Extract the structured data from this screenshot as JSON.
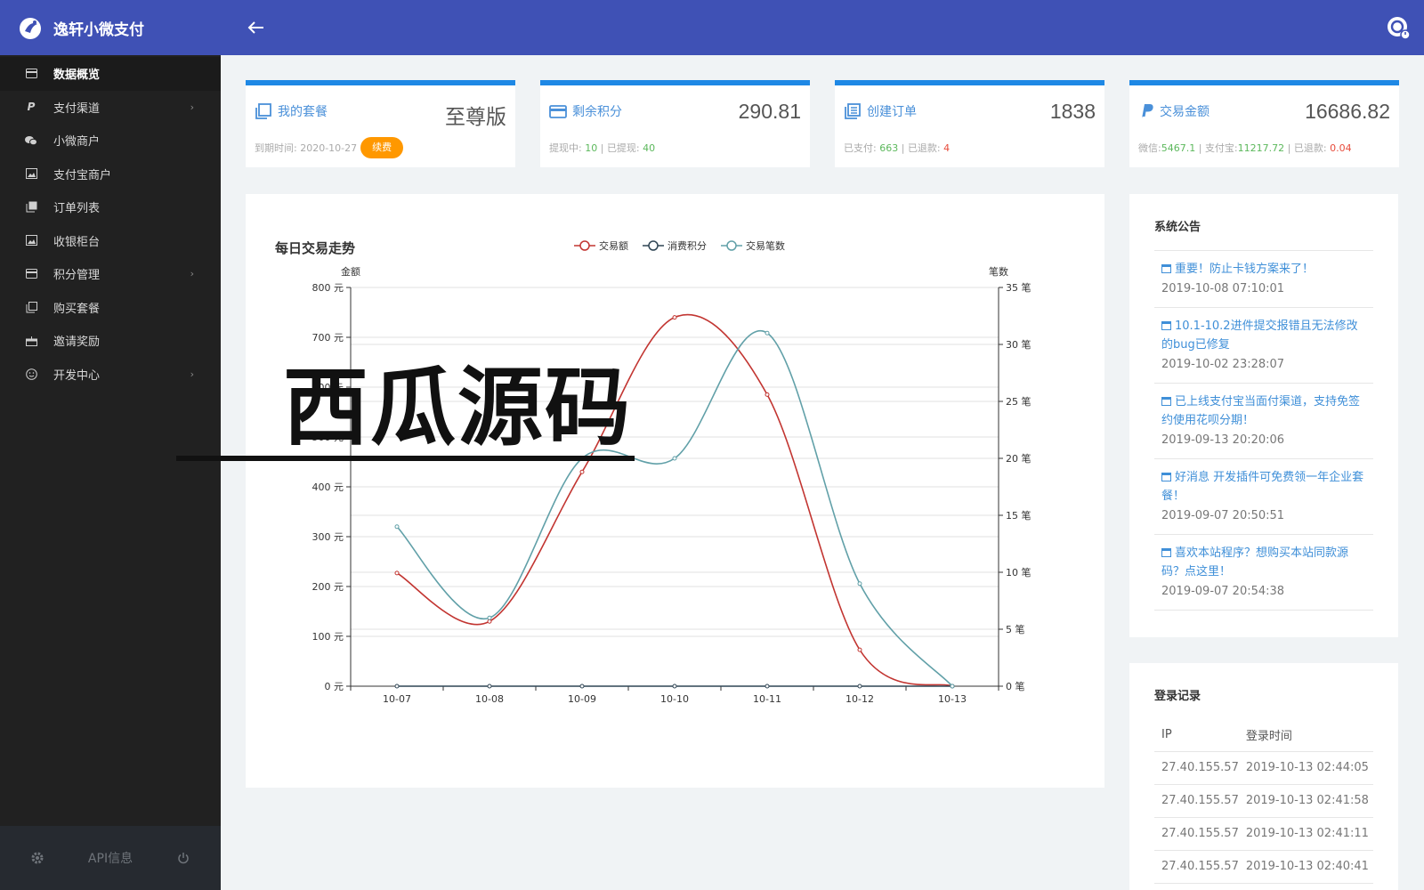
{
  "app": {
    "title": "逸轩小微支付"
  },
  "sidebar": {
    "items": [
      {
        "label": "数据概览",
        "icon": "card-icon",
        "active": true,
        "chevron": false
      },
      {
        "label": "支付渠道",
        "icon": "paypal-p-icon",
        "active": false,
        "chevron": true
      },
      {
        "label": "小微商户",
        "icon": "wechat-icon",
        "active": false,
        "chevron": false
      },
      {
        "label": "支付宝商户",
        "icon": "image-icon",
        "active": false,
        "chevron": false
      },
      {
        "label": "订单列表",
        "icon": "copy-icon",
        "active": false,
        "chevron": false
      },
      {
        "label": "收银柜台",
        "icon": "image-icon",
        "active": false,
        "chevron": false
      },
      {
        "label": "积分管理",
        "icon": "card-icon",
        "active": false,
        "chevron": true
      },
      {
        "label": "购买套餐",
        "icon": "clone-icon",
        "active": false,
        "chevron": false
      },
      {
        "label": "邀请奖励",
        "icon": "gift-icon",
        "active": false,
        "chevron": false
      },
      {
        "label": "开发中心",
        "icon": "smile-icon",
        "active": false,
        "chevron": true
      }
    ],
    "footer": {
      "api_label": "API信息"
    }
  },
  "stats": {
    "package": {
      "label": "我的套餐",
      "value": "至尊版",
      "expire_label": "到期时间:",
      "expire_date": "2020-10-27",
      "renew_label": "续费"
    },
    "points": {
      "label": "剩余积分",
      "value": "290.81",
      "withdrawing_label": "提现中:",
      "withdrawing": "10",
      "sep": "|",
      "withdrawn_label": "已提现:",
      "withdrawn": "40"
    },
    "orders": {
      "label": "创建订单",
      "value": "1838",
      "paid_label": "已支付:",
      "paid": "663",
      "sep": "|",
      "refunded_label": "已退款:",
      "refunded": "4"
    },
    "amount": {
      "label": "交易金额",
      "value": "16686.82",
      "wechat_label": "微信:",
      "wechat": "5467.1",
      "sep1": "|",
      "alipay_label": "支付宝:",
      "alipay": "11217.72",
      "sep2": "|",
      "refunded_label": "已退款:",
      "refunded": "0.04"
    }
  },
  "chart_data": {
    "type": "line",
    "title": "每日交易走势",
    "categories": [
      "10-07",
      "10-08",
      "10-09",
      "10-10",
      "10-11",
      "10-12",
      "10-13"
    ],
    "y_left": {
      "label": "金额",
      "min": 0,
      "max": 800,
      "ticks": [
        0,
        100,
        200,
        300,
        400,
        500,
        600,
        700,
        800
      ],
      "unit": "元"
    },
    "y_right": {
      "label": "笔数",
      "min": 0,
      "max": 35,
      "ticks": [
        0,
        5,
        10,
        15,
        20,
        25,
        30,
        35
      ],
      "unit": "笔"
    },
    "legend_position": "top-center",
    "grid": true,
    "series": [
      {
        "name": "交易额",
        "axis": "left",
        "color": "#c23531",
        "values": [
          227,
          130,
          430,
          740,
          585,
          73,
          0
        ]
      },
      {
        "name": "消费积分",
        "axis": "left",
        "color": "#2f4554",
        "values": [
          0,
          0,
          0,
          0,
          0,
          0,
          0
        ]
      },
      {
        "name": "交易笔数",
        "axis": "right",
        "color": "#61a0a8",
        "values": [
          14,
          6,
          20,
          20,
          31,
          9,
          0
        ]
      }
    ]
  },
  "notices": {
    "title": "系统公告",
    "items": [
      {
        "text": "重要！防止卡钱方案来了！",
        "time": "2019-10-08 07:10:01"
      },
      {
        "text": "10.1-10.2进件提交报错且无法修改的bug已修复",
        "time": "2019-10-02 23:28:07"
      },
      {
        "text": "已上线支付宝当面付渠道，支持免签约使用花呗分期！",
        "time": "2019-09-13 20:20:06"
      },
      {
        "text": "好消息 开发插件可免费领一年企业套餐！",
        "time": "2019-09-07 20:50:51"
      },
      {
        "text": "喜欢本站程序？想购买本站同款源码？点这里！",
        "time": "2019-09-07 20:54:38"
      }
    ]
  },
  "login_records": {
    "title": "登录记录",
    "columns": [
      "IP",
      "登录时间"
    ],
    "rows": [
      [
        "27.40.155.57",
        "2019-10-13 02:44:05"
      ],
      [
        "27.40.155.57",
        "2019-10-13 02:41:58"
      ],
      [
        "27.40.155.57",
        "2019-10-13 02:41:11"
      ],
      [
        "27.40.155.57",
        "2019-10-13 02:40:41"
      ]
    ]
  },
  "watermark": {
    "text": "西瓜源码"
  }
}
